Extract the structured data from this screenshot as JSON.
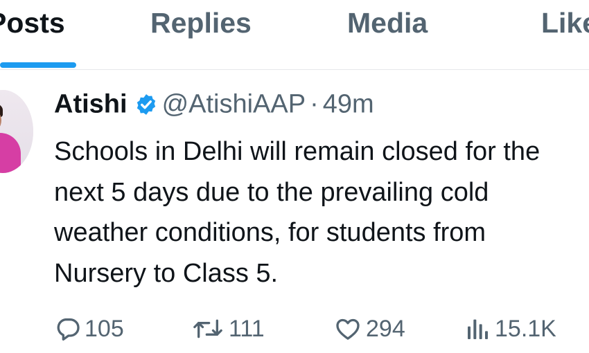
{
  "tabs": [
    {
      "label": "Posts",
      "active": true
    },
    {
      "label": "Replies",
      "active": false
    },
    {
      "label": "Media",
      "active": false
    },
    {
      "label": "Likes",
      "active": false
    }
  ],
  "tweet": {
    "author": "Atishi",
    "handle": "@AtishiAAP",
    "separator": "·",
    "time": "49m",
    "text": "Schools in Delhi will remain closed for the\nnext 5 days due to the prevailing cold\nweather conditions, for students from\nNursery to Class 5.",
    "verified_color": "#1d9bf0"
  },
  "actions": {
    "replies": "105",
    "reposts": "111",
    "likes": "294",
    "views": "15.1K"
  }
}
